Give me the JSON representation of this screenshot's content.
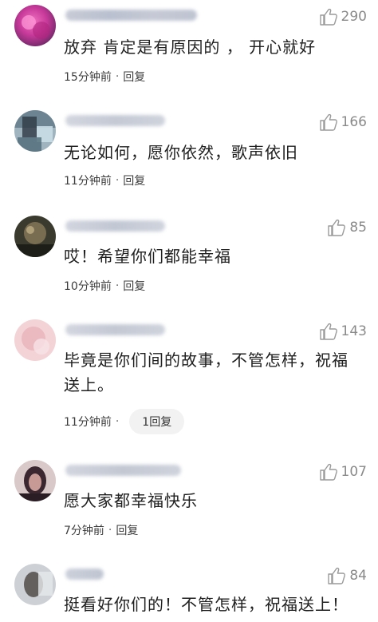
{
  "comments": [
    {
      "likes": "290",
      "content": "放弃 肯定是有原因的 ， 开心就好",
      "time": "15分钟前",
      "separator": "·",
      "reply": "回复"
    },
    {
      "likes": "166",
      "content": "无论如何，愿你依然，歌声依旧",
      "time": "11分钟前",
      "separator": "·",
      "reply": "回复"
    },
    {
      "likes": "85",
      "content": "哎！希望你们都能幸福",
      "time": "10分钟前",
      "separator": "·",
      "reply": "回复"
    },
    {
      "likes": "143",
      "content_line1": "毕竟是你们间的故事，不管怎样，祝福",
      "content_line2": "送上。",
      "time": "11分钟前",
      "separator": "·",
      "reply": "1回复"
    },
    {
      "likes": "107",
      "content": "愿大家都幸福快乐",
      "time": "7分钟前",
      "separator": "·",
      "reply": "回复"
    },
    {
      "likes": "84",
      "content": "挺看好你们的！不管怎样，祝福送上！"
    }
  ],
  "icons": {
    "like": "thumbs-up-icon"
  },
  "colors": {
    "meta_text": "#3c3c3c",
    "like_text": "#8a8a8a",
    "reply_pill_bg": "#f2f2f2"
  }
}
